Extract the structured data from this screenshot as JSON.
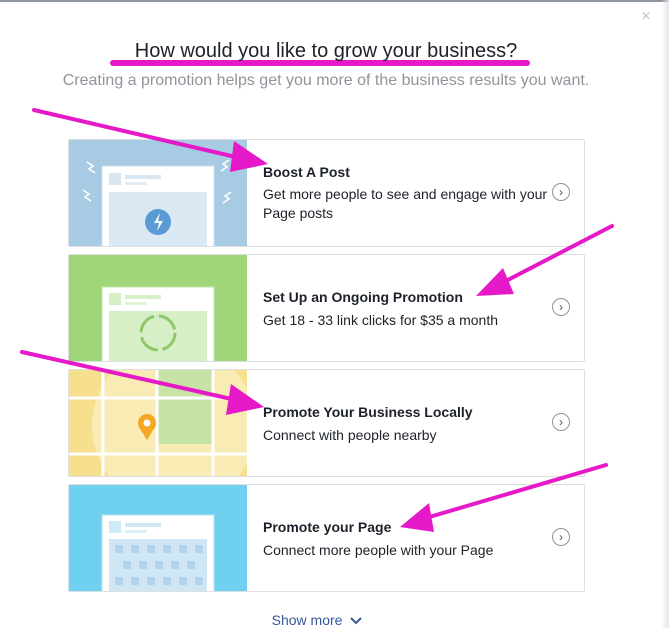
{
  "dialog": {
    "title": "How would you like to grow your business?",
    "subtitle": "Creating a promotion helps get you more of the business results you want.",
    "close_glyph": "×",
    "show_more": "Show more",
    "show_more_icon": "chevron-down-icon"
  },
  "options": [
    {
      "title": "Boost A Post",
      "description": "Get more people to see and engage with your Page posts",
      "icon": "lightning-bolt-icon",
      "color": "#a6cbe3"
    },
    {
      "title": "Set Up an Ongoing Promotion",
      "description": "Get 18 - 33 link clicks for $35 a month",
      "icon": "refresh-cycle-icon",
      "color": "#9fd67a"
    },
    {
      "title": "Promote Your Business Locally",
      "description": "Connect with people nearby",
      "icon": "map-pin-icon",
      "color": "#f6e08e"
    },
    {
      "title": "Promote your Page",
      "description": "Connect more people with your Page",
      "icon": "thumbs-up-icon",
      "color": "#6fd0f0"
    }
  ],
  "annotation_color": "#e619c8"
}
